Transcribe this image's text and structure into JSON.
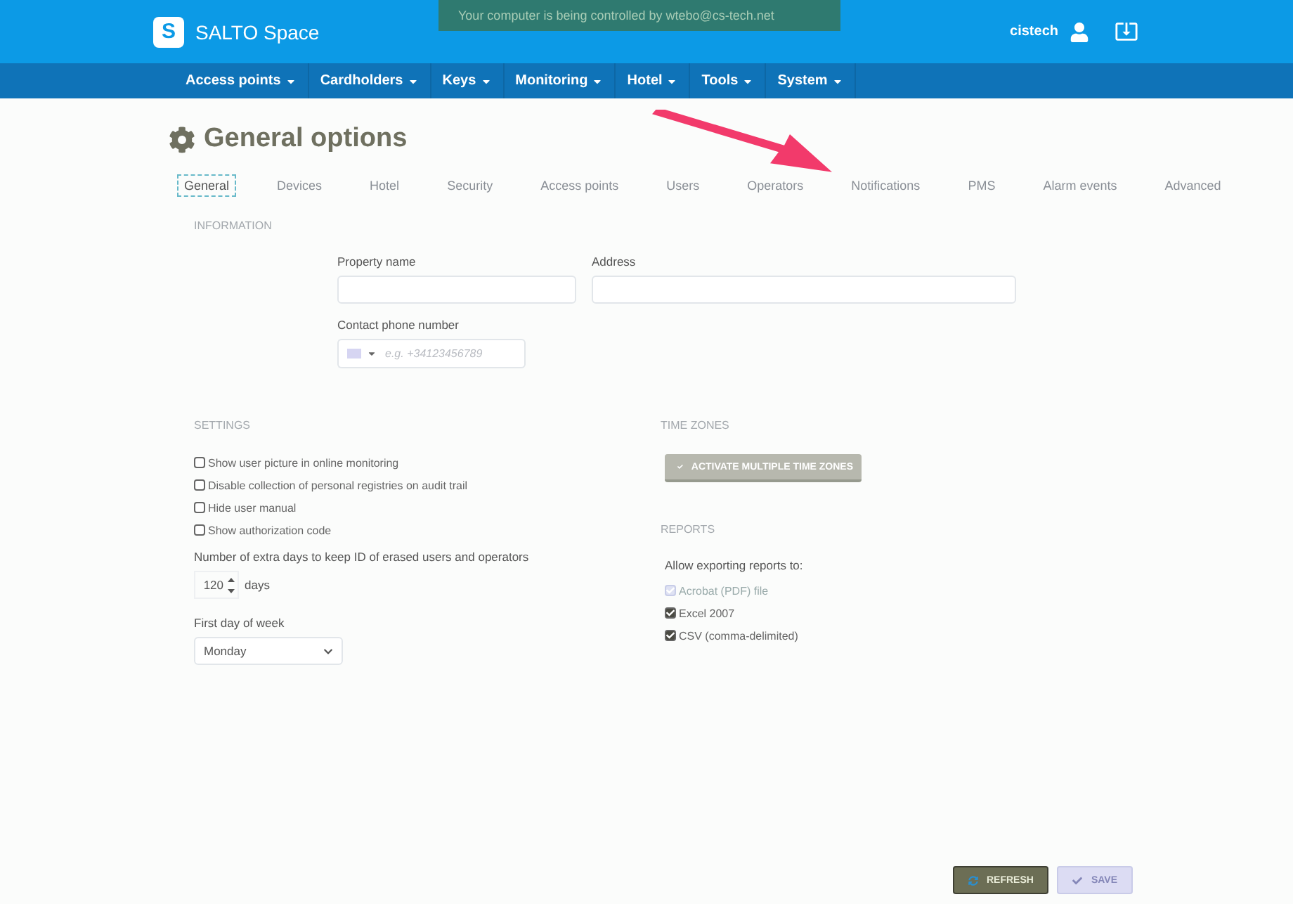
{
  "remote_banner": {
    "text": "Your computer is being controlled by wtebo@cs-tech.net"
  },
  "header": {
    "logo_letter": "S",
    "app_name": "SALTO Space",
    "user": "cistech"
  },
  "nav": [
    {
      "label": "Access points"
    },
    {
      "label": "Cardholders"
    },
    {
      "label": "Keys"
    },
    {
      "label": "Monitoring"
    },
    {
      "label": "Hotel"
    },
    {
      "label": "Tools"
    },
    {
      "label": "System"
    }
  ],
  "page_title": "General options",
  "tabs": [
    {
      "label": "General",
      "selected": true
    },
    {
      "label": "Devices",
      "selected": false
    },
    {
      "label": "Hotel",
      "selected": false
    },
    {
      "label": "Security",
      "selected": false
    },
    {
      "label": "Access points",
      "selected": false
    },
    {
      "label": "Users",
      "selected": false
    },
    {
      "label": "Operators",
      "selected": false
    },
    {
      "label": "Notifications",
      "selected": false
    },
    {
      "label": "PMS",
      "selected": false
    },
    {
      "label": "Alarm events",
      "selected": false
    },
    {
      "label": "Advanced",
      "selected": false
    }
  ],
  "information": {
    "heading": "INFORMATION",
    "property_name": {
      "label": "Property name"
    },
    "address": {
      "label": "Address"
    },
    "phone": {
      "label": "Contact phone number",
      "placeholder": "e.g. +34123456789"
    }
  },
  "settings": {
    "heading": "SETTINGS",
    "options": [
      {
        "label": "Show user picture in online monitoring",
        "checked": false
      },
      {
        "label": "Disable collection of personal registries on audit trail",
        "checked": false
      },
      {
        "label": "Hide user manual",
        "checked": false
      },
      {
        "label": "Show authorization code",
        "checked": false
      }
    ],
    "extra_days": {
      "label": "Number of extra days to keep ID of erased users and operators",
      "value": "120",
      "unit": "days"
    },
    "first_day": {
      "label": "First day of week",
      "value": "Monday"
    }
  },
  "time_zones": {
    "heading": "TIME ZONES",
    "button": "ACTIVATE MULTIPLE TIME ZONES"
  },
  "reports": {
    "heading": "REPORTS",
    "label": "Allow exporting reports to:",
    "formats": [
      {
        "label": "Acrobat (PDF) file",
        "checked": true,
        "disabled": true
      },
      {
        "label": "Excel 2007",
        "checked": true,
        "disabled": false
      },
      {
        "label": "CSV (comma-delimited)",
        "checked": true,
        "disabled": false
      }
    ]
  },
  "footer_buttons": [
    {
      "label": "REFRESH",
      "kind": "refresh",
      "disabled": false
    },
    {
      "label": "SAVE",
      "kind": "save",
      "disabled": true
    }
  ]
}
